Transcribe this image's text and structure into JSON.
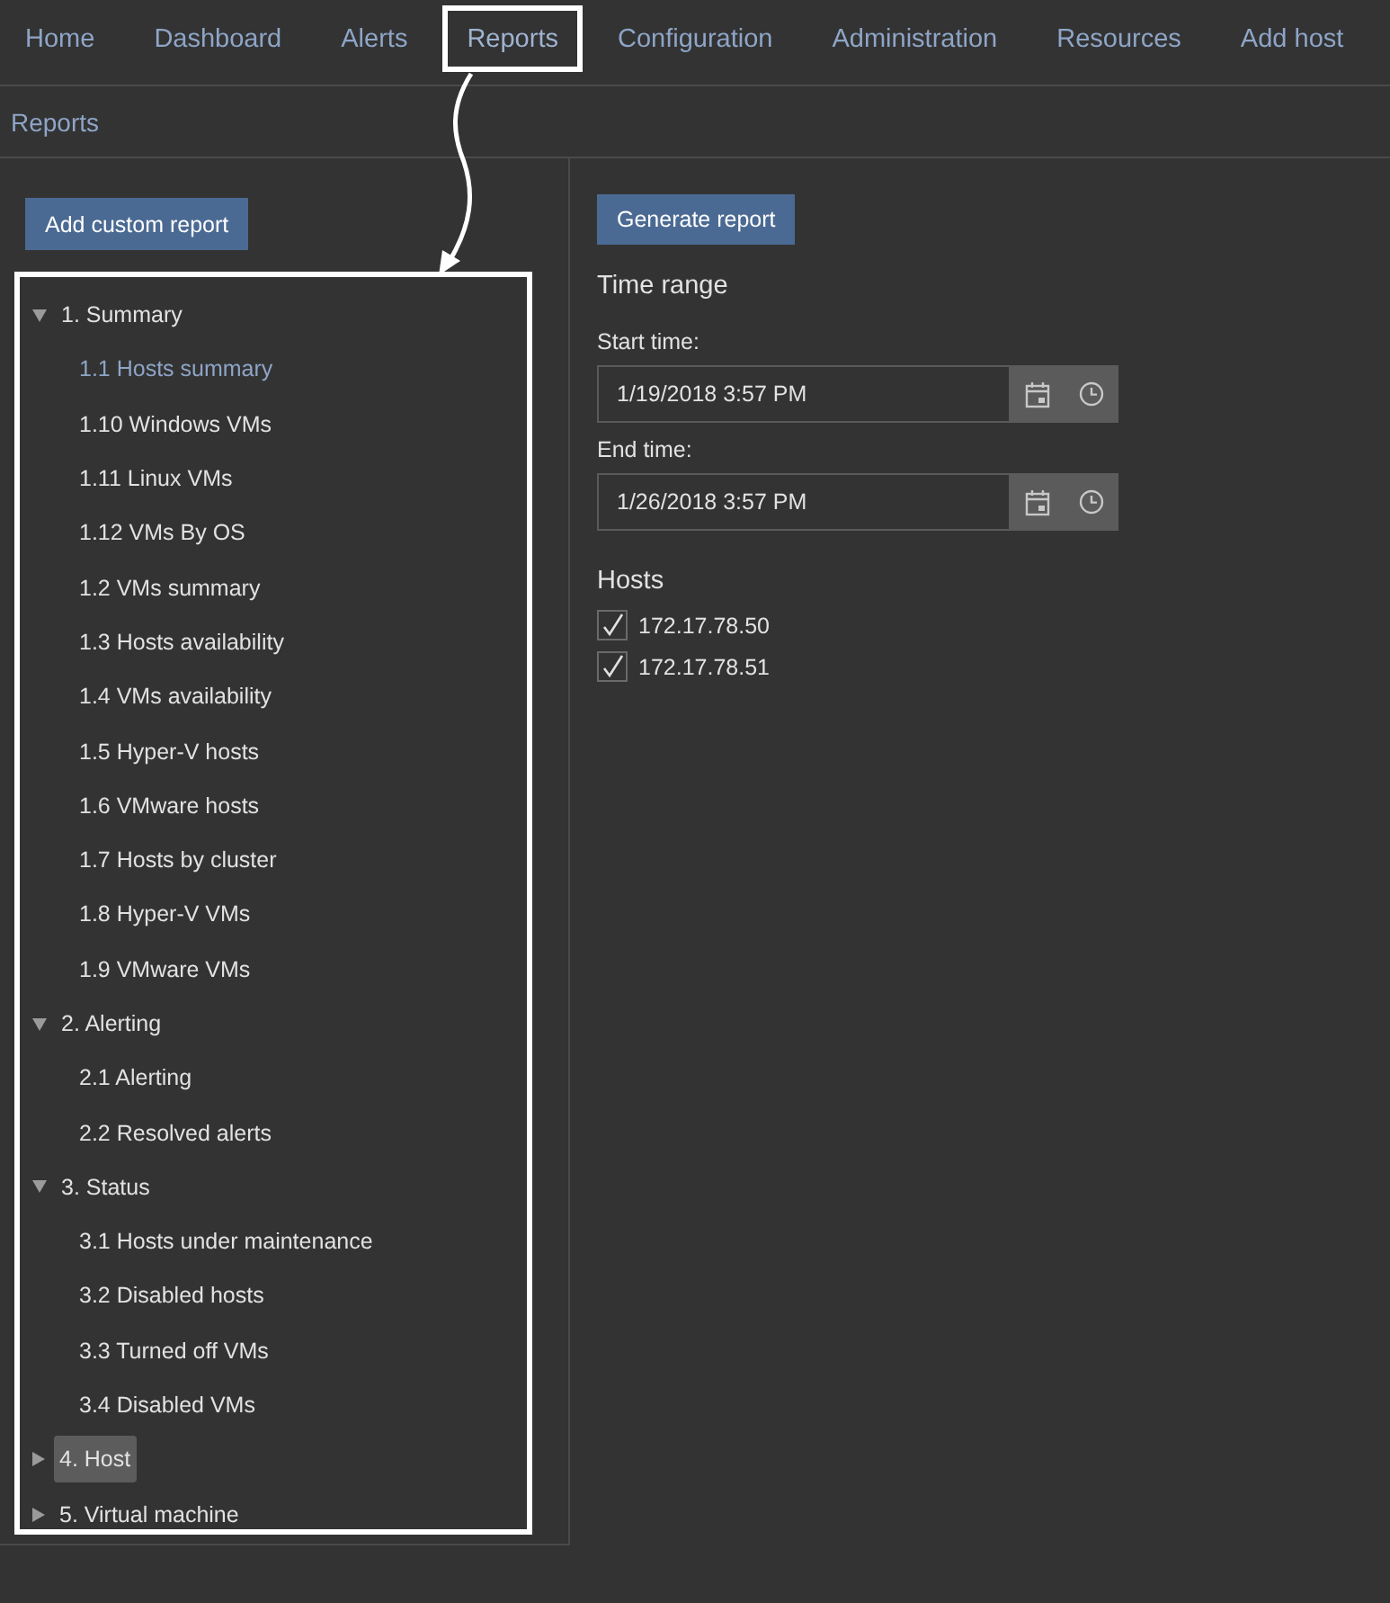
{
  "nav": {
    "items": [
      {
        "label": "Home",
        "selected": false,
        "callout": false
      },
      {
        "label": "Dashboard",
        "selected": false,
        "callout": false
      },
      {
        "label": "Alerts",
        "selected": false,
        "callout": false
      },
      {
        "label": "Reports",
        "selected": true,
        "callout": true
      },
      {
        "label": "Configuration",
        "selected": false,
        "callout": false
      },
      {
        "label": "Administration",
        "selected": false,
        "callout": false
      },
      {
        "label": "Resources",
        "selected": false,
        "callout": false
      },
      {
        "label": "Add host",
        "selected": false,
        "callout": false
      }
    ]
  },
  "breadcrumb": "Reports",
  "sidebar": {
    "add_button": "Add custom report",
    "tree": {
      "callout": true,
      "items": [
        {
          "label": "1. Summary",
          "expanded": true,
          "hovered": false,
          "children": [
            {
              "label": "1.1 Hosts summary",
              "selected": true
            },
            {
              "label": "1.10 Windows VMs",
              "selected": false
            },
            {
              "label": "1.11 Linux VMs",
              "selected": false
            },
            {
              "label": "1.12 VMs By OS",
              "selected": false
            },
            {
              "label": "1.2 VMs summary",
              "selected": false
            },
            {
              "label": "1.3 Hosts availability",
              "selected": false
            },
            {
              "label": "1.4 VMs availability",
              "selected": false
            },
            {
              "label": "1.5 Hyper-V hosts",
              "selected": false
            },
            {
              "label": "1.6 VMware hosts",
              "selected": false
            },
            {
              "label": "1.7 Hosts by cluster",
              "selected": false
            },
            {
              "label": "1.8 Hyper-V VMs",
              "selected": false
            },
            {
              "label": "1.9 VMware VMs",
              "selected": false
            }
          ]
        },
        {
          "label": "2. Alerting",
          "expanded": true,
          "hovered": false,
          "children": [
            {
              "label": "2.1 Alerting",
              "selected": false
            },
            {
              "label": "2.2 Resolved alerts",
              "selected": false
            }
          ]
        },
        {
          "label": "3. Status",
          "expanded": true,
          "hovered": false,
          "children": [
            {
              "label": "3.1 Hosts under maintenance",
              "selected": false
            },
            {
              "label": "3.2 Disabled hosts",
              "selected": false
            },
            {
              "label": "3.3 Turned off VMs",
              "selected": false
            },
            {
              "label": "3.4 Disabled VMs",
              "selected": false
            }
          ]
        },
        {
          "label": "4. Host",
          "expanded": false,
          "hovered": true
        },
        {
          "label": "5. Virtual machine",
          "expanded": false,
          "hovered": false
        }
      ]
    }
  },
  "form": {
    "generate_button": "Generate report",
    "time_range_heading": "Time range",
    "fields": [
      {
        "label": "Start time:",
        "value": "1/19/2018 3:57 PM"
      },
      {
        "label": "End time:",
        "value": "1/26/2018 3:57 PM"
      }
    ],
    "hosts_heading": "Hosts",
    "hosts": [
      {
        "label": "172.17.78.50",
        "checked": true
      },
      {
        "label": "172.17.78.51",
        "checked": true
      }
    ]
  }
}
